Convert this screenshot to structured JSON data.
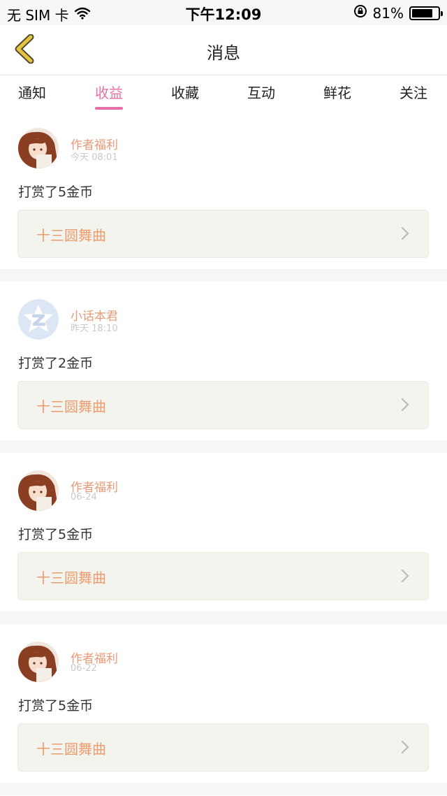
{
  "status_bar": {
    "carrier": "无 SIM 卡",
    "time": "下午12:09",
    "battery_percent": "81%",
    "battery_level": 0.81
  },
  "nav": {
    "title": "消息"
  },
  "tabs": [
    {
      "label": "通知"
    },
    {
      "label": "收益",
      "active": true
    },
    {
      "label": "收藏"
    },
    {
      "label": "互动"
    },
    {
      "label": "鲜花"
    },
    {
      "label": "关注"
    }
  ],
  "messages": [
    {
      "sender": "作者福利",
      "time": "今天 08:01",
      "text": "打赏了5金币",
      "link": "十三圆舞曲",
      "avatar": "anime-avatar"
    },
    {
      "sender": "小话本君",
      "time": "昨天 18:10",
      "text": "打赏了2金币",
      "link": "十三圆舞曲",
      "avatar": "z-logo-avatar"
    },
    {
      "sender": "作者福利",
      "time": "06-24",
      "text": "打赏了5金币",
      "link": "十三圆舞曲",
      "avatar": "anime-avatar"
    },
    {
      "sender": "作者福利",
      "time": "06-22",
      "text": "打赏了5金币",
      "link": "十三圆舞曲",
      "avatar": "anime-avatar"
    }
  ],
  "colors": {
    "accent_pink": "#e56fa6",
    "sender_orange": "#e79a76",
    "link_orange": "#eb9c6f",
    "back_yellow": "#e5c341"
  }
}
